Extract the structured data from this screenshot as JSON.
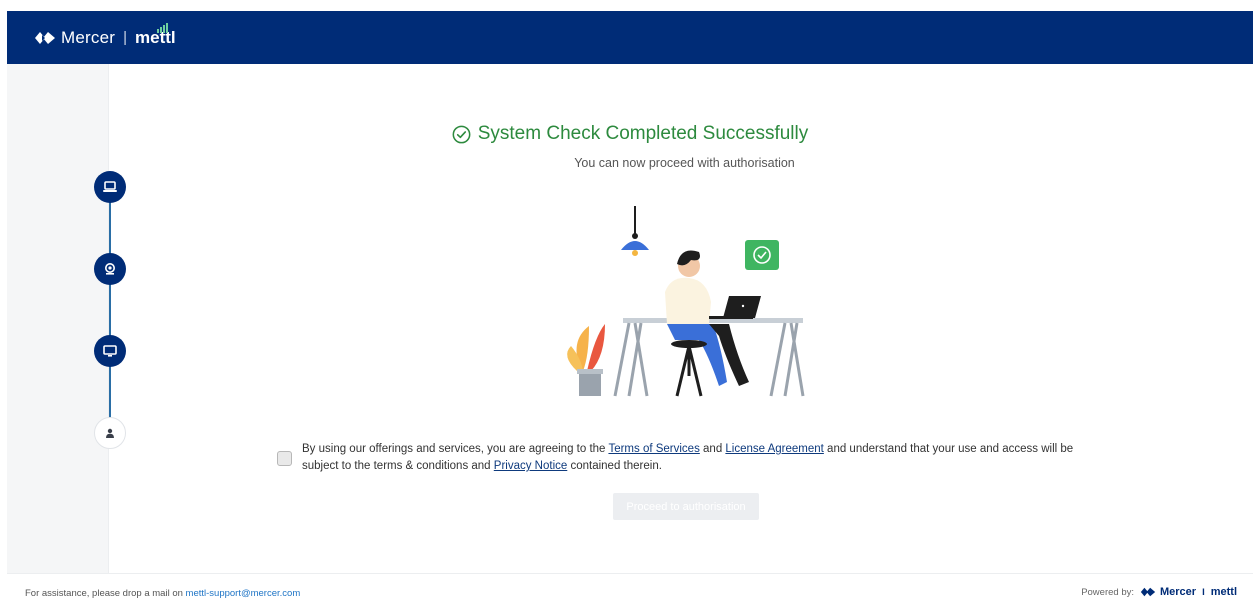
{
  "header": {
    "brand": "Mercer",
    "separator": "|",
    "product": "mettl"
  },
  "sidebar": {
    "steps": [
      {
        "icon": "laptop-icon",
        "status": "completed"
      },
      {
        "icon": "webcam-icon",
        "status": "completed"
      },
      {
        "icon": "monitor-icon",
        "status": "completed"
      },
      {
        "icon": "user-icon",
        "status": "pending"
      }
    ]
  },
  "main": {
    "title": "System Check Completed Successfully",
    "subtitle": "You can now proceed with authorisation",
    "consent": {
      "text_1": "By using our offerings and services, you are agreeing to the ",
      "terms_link": "Terms of Services",
      "text_2": " and ",
      "license_link": "License Agreement",
      "text_3": " and understand that your use and access will be subject to the terms & conditions and ",
      "privacy_link": "Privacy Notice",
      "text_4": " contained therein.",
      "checked": false
    },
    "proceed_label": "Proceed to authorisation"
  },
  "footer": {
    "assist_text": "For assistance, please drop a mail on ",
    "assist_email": "mettl-support@mercer.com",
    "powered_by": "Powered by:",
    "brand": "Mercer",
    "separator": "I",
    "product": "mettl"
  },
  "colors": {
    "header_bg": "#002c77",
    "success": "#2d8a3e",
    "link": "#0e3a7d"
  }
}
